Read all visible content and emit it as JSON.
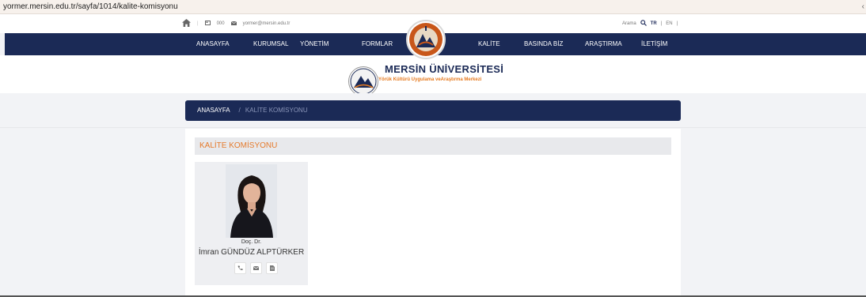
{
  "browser": {
    "url": "yormer.mersin.edu.tr/sayfa/1014/kalite-komisyonu",
    "more_glyph": "‹"
  },
  "topbar": {
    "phone": "000",
    "email": "yormer@mersin.edu.tr",
    "search_label": "Arama",
    "lang_tr": "TR",
    "lang_en": "EN",
    "lang_separator": "|"
  },
  "nav": {
    "items": [
      "ANASAYFA",
      "KURUMSAL",
      "YÖNETİM",
      "FORMLAR",
      "KALİTE",
      "BASINDA BİZ",
      "ARAŞTIRMA",
      "İLETİŞİM"
    ]
  },
  "header": {
    "title": "MERSİN ÜNİVERSİTESİ",
    "subtitle": "Yörük Kültürü Uygulama veAraştırma Merkezi"
  },
  "breadcrumb": {
    "home": "ANASAYFA",
    "separator": "/",
    "current": "KALİTE KOMİSYONU"
  },
  "section": {
    "title": "KALİTE KOMİSYONU"
  },
  "person": {
    "title": "Doç. Dr.",
    "name": "İmran GÜNDÜZ ALPTÜRKER",
    "icons": [
      "phone-icon",
      "envelope-icon",
      "document-icon"
    ]
  },
  "colors": {
    "navy": "#1b2a56",
    "accent": "#e57a2b",
    "background": "#f2f3f6"
  }
}
